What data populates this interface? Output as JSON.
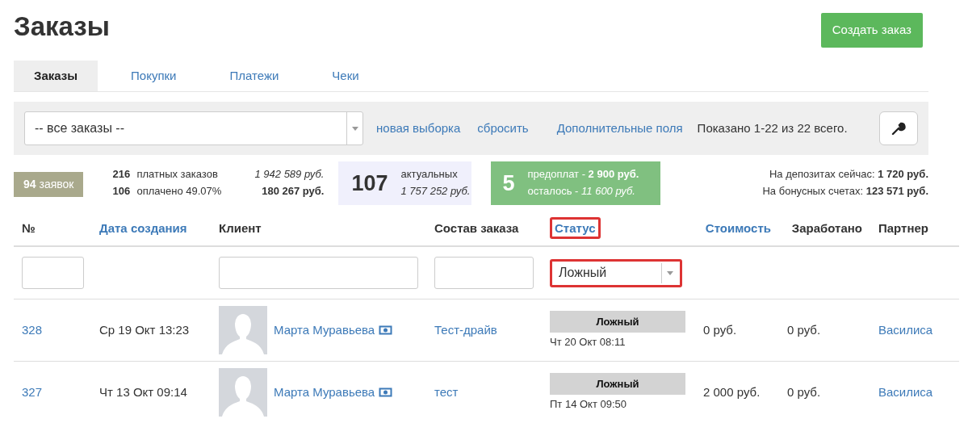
{
  "title": "Заказы",
  "create_button": "Создать заказ",
  "tabs": [
    {
      "label": "Заказы",
      "selected": true
    },
    {
      "label": "Покупки",
      "selected": false
    },
    {
      "label": "Платежи",
      "selected": false
    },
    {
      "label": "Чеки",
      "selected": false
    }
  ],
  "filter_bar": {
    "select": "-- все заказы --",
    "links": [
      "новая выборка",
      "сбросить",
      "Дополнительные поля"
    ],
    "summary": "Показано 1-22 из 22 всего."
  },
  "stats": {
    "requests": "**94** заявок",
    "summary_rows": [
      {
        "count": "216",
        "label": "платных заказов",
        "amount": "*1 942 589 руб.*"
      },
      {
        "count": "106",
        "label": "оплачено 49.07%",
        "amount": "**180 267 руб.**"
      }
    ],
    "actual": {
      "count": "107",
      "label": "актуальных",
      "amount": "1 757 252 руб."
    },
    "prepaid": {
      "count": "5",
      "lines": [
        "предоплат - **2 900 руб.**",
        "осталось - *11 600 руб.*"
      ]
    },
    "balances": [
      "На депозитах сейчас: **1 720 руб.**",
      "На бонусных счетах: **123 571 руб.**"
    ]
  },
  "table": {
    "columns": [
      {
        "label": "№",
        "sortable": false,
        "highlighted": false
      },
      {
        "label": "Дата создания",
        "sortable": true,
        "highlighted": false
      },
      {
        "label": "Клиент",
        "sortable": false,
        "highlighted": false
      },
      {
        "label": "Состав заказа",
        "sortable": false,
        "highlighted": false
      },
      {
        "label": "Статус",
        "sortable": true,
        "highlighted": true
      },
      {
        "label": "Стоимость",
        "sortable": true,
        "highlighted": false
      },
      {
        "label": "Заработано",
        "sortable": false,
        "highlighted": false
      },
      {
        "label": "Партнер",
        "sortable": false,
        "highlighted": false
      }
    ],
    "filters": [
      {
        "kind": "input"
      },
      {
        "kind": "none"
      },
      {
        "kind": "input"
      },
      {
        "kind": "input"
      },
      {
        "kind": "select",
        "value": "Ложный",
        "highlighted": true
      },
      {
        "kind": "none"
      },
      {
        "kind": "none"
      },
      {
        "kind": "none"
      }
    ],
    "rows": [
      {
        "number": "328",
        "created": "Ср 19 Окт 13:23",
        "client": "Марта Муравьева",
        "contents": "Тест-драйв",
        "status": "Ложный",
        "status_date": "Чт 20 Окт 08:11",
        "cost": "0 руб.",
        "earned": "0 руб.",
        "partner": "Василиса"
      },
      {
        "number": "327",
        "created": "Чт 13 Окт 09:14",
        "client": "Марта Муравьева",
        "contents": "тест",
        "status": "Ложный",
        "status_date": "Пт 14 Окт 09:50",
        "cost": "2 000 руб.",
        "earned": "0 руб.",
        "partner": "Василиса"
      }
    ]
  }
}
